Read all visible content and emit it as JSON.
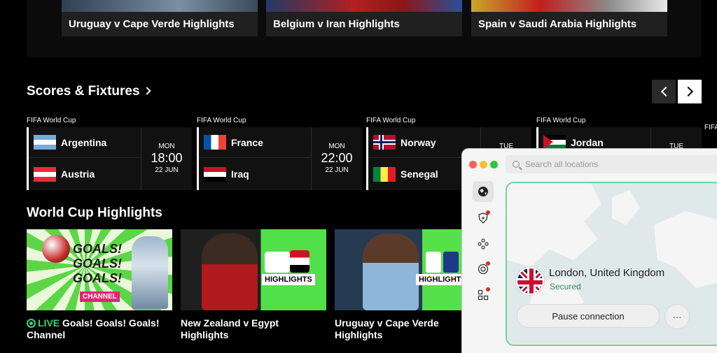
{
  "top_highlights": [
    {
      "title": "Uruguay v Cape Verde Highlights"
    },
    {
      "title": "Belgium v Iran Highlights"
    },
    {
      "title": "Spain v Saudi Arabia Highlights"
    }
  ],
  "scores": {
    "title": "Scores & Fixtures",
    "fixtures": [
      {
        "competition": "FIFA World Cup",
        "team1": "Argentina",
        "team2": "Austria",
        "day": "MON",
        "time": "18:00",
        "date": "22 JUN"
      },
      {
        "competition": "FIFA World Cup",
        "team1": "France",
        "team2": "Iraq",
        "day": "MON",
        "time": "22:00",
        "date": "22 JUN"
      },
      {
        "competition": "FIFA World Cup",
        "team1": "Norway",
        "team2": "Senegal",
        "day": "TUE"
      },
      {
        "competition": "FIFA World Cup",
        "team1": "Jordan",
        "day": "TUE"
      },
      {
        "competition": "FIFA"
      }
    ]
  },
  "highlights": {
    "title": "World Cup Highlights",
    "items": [
      {
        "live_label": "LIVE",
        "title": "Goals! Goals! Goals! Channel",
        "thumb_text": "GOALS! GOALS! GOALS!",
        "badge": "CHANNEL"
      },
      {
        "title": "New Zealand v Egypt Highlights",
        "badge": "HIGHLIGHTS"
      },
      {
        "title": "Uruguay v Cape Verde Highlights",
        "badge": "HIGHLIGHTS"
      }
    ]
  },
  "vpn": {
    "search_placeholder": "Search all locations",
    "location": "London, United Kingdom",
    "status": "Secured",
    "pause_label": "Pause connection",
    "more_label": "···",
    "sidebar_icons": [
      "globe-icon",
      "shield-bolt-icon",
      "mesh-icon",
      "target-icon",
      "apps-icon"
    ]
  },
  "colors": {
    "accent_green": "#37d57a",
    "vpn_border": "#6fd69b",
    "badge_pink": "#e0247a"
  }
}
